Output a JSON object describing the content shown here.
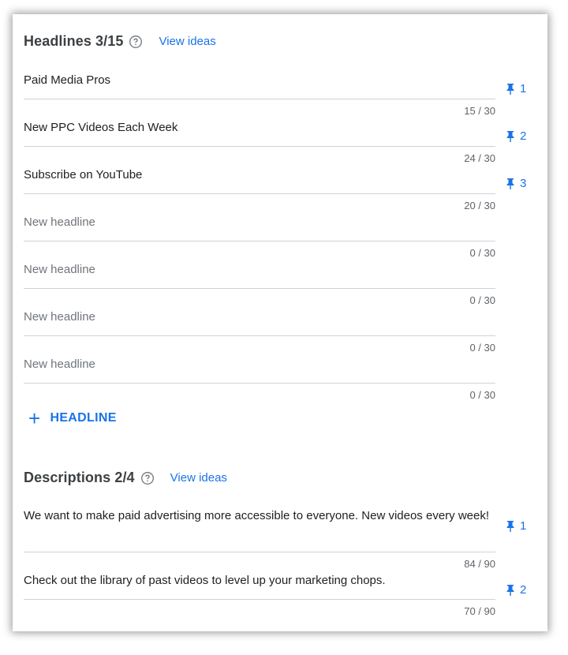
{
  "headlines": {
    "title": "Headlines 3/15",
    "view_ideas": "View ideas",
    "fields": [
      {
        "text": "Paid Media Pros",
        "counter": "15 / 30",
        "pin": "1",
        "placeholder": false
      },
      {
        "text": "New PPC Videos Each Week",
        "counter": "24 / 30",
        "pin": "2",
        "placeholder": false
      },
      {
        "text": "Subscribe on YouTube",
        "counter": "20 / 30",
        "pin": "3",
        "placeholder": false
      },
      {
        "text": "New headline",
        "counter": "0 / 30",
        "pin": "",
        "placeholder": true
      },
      {
        "text": "New headline",
        "counter": "0 / 30",
        "pin": "",
        "placeholder": true
      },
      {
        "text": "New headline",
        "counter": "0 / 30",
        "pin": "",
        "placeholder": true
      },
      {
        "text": "New headline",
        "counter": "0 / 30",
        "pin": "",
        "placeholder": true
      }
    ],
    "add_label": "HEADLINE"
  },
  "descriptions": {
    "title": "Descriptions 2/4",
    "view_ideas": "View ideas",
    "fields": [
      {
        "text": "We want to make paid advertising more accessible to everyone. New videos every week!",
        "counter": "84 / 90",
        "pin": "1"
      },
      {
        "text": "Check out the library of past videos to level up your marketing chops.",
        "counter": "70 / 90",
        "pin": "2"
      }
    ]
  },
  "colors": {
    "accent": "#1a73e8",
    "text": "#202124",
    "placeholder": "#70757a",
    "divider": "#cfd2d6"
  },
  "icons": {
    "help": "help-circle-icon",
    "pin": "pin-icon",
    "add": "plus-icon"
  }
}
